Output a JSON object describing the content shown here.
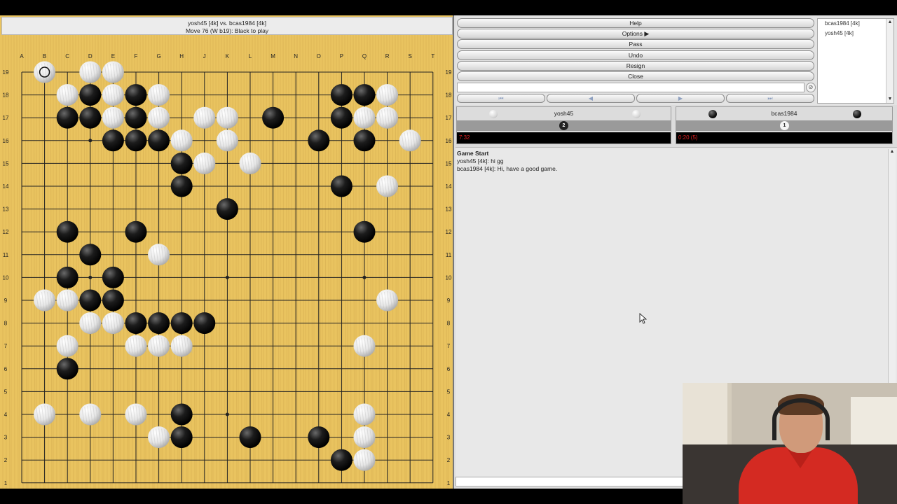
{
  "board": {
    "title": "yosh45 [4k] vs. bcas1984 [4k]",
    "status": "Move 76 (W b19): Black to play",
    "columns": [
      "A",
      "B",
      "C",
      "D",
      "E",
      "F",
      "G",
      "H",
      "J",
      "K",
      "L",
      "M",
      "N",
      "O",
      "P",
      "Q",
      "R",
      "S",
      "T"
    ],
    "rows": [
      "19",
      "18",
      "17",
      "16",
      "15",
      "14",
      "13",
      "12",
      "11",
      "10",
      "9",
      "8",
      "7",
      "6",
      "5",
      "4",
      "3",
      "2",
      "1"
    ],
    "last_move": "B19",
    "black_stones": [
      "D18",
      "F18",
      "P18",
      "Q18",
      "C17",
      "D17",
      "F17",
      "M17",
      "P17",
      "E16",
      "F16",
      "G16",
      "O16",
      "Q16",
      "H15",
      "H14",
      "P14",
      "K13",
      "C12",
      "F12",
      "Q12",
      "D11",
      "C10",
      "E10",
      "D9",
      "E9",
      "F8",
      "G8",
      "H8",
      "J8",
      "C6",
      "H4",
      "H3",
      "L3",
      "O3",
      "P2"
    ],
    "white_stones": [
      "B19",
      "D19",
      "E19",
      "C18",
      "E18",
      "G18",
      "R18",
      "E17",
      "G17",
      "J17",
      "K17",
      "Q17",
      "R17",
      "H16",
      "K16",
      "S16",
      "J15",
      "L15",
      "R14",
      "G11",
      "B9",
      "C9",
      "R9",
      "D8",
      "E8",
      "C7",
      "F7",
      "G7",
      "H7",
      "Q7",
      "B4",
      "D4",
      "F4",
      "Q4",
      "G3",
      "Q3",
      "Q2"
    ]
  },
  "controls": {
    "help_label": "Help",
    "options_label": "Options",
    "pass_label": "Pass",
    "undo_label": "Undo",
    "resign_label": "Resign",
    "close_label": "Close",
    "nav": {
      "first": "⏮",
      "prev": "◀",
      "next": "▶",
      "last": "⏭"
    },
    "clear_icon": "⊘"
  },
  "player_list": [
    "bcas1984 [4k]",
    "yosh45 [4k]"
  ],
  "players": {
    "white": {
      "name": "yosh45",
      "captures": "2",
      "clock": "7:32"
    },
    "black": {
      "name": "bcas1984",
      "captures": "1",
      "clock": "0:20 (5)"
    }
  },
  "chat": {
    "heading": "Game Start",
    "lines": [
      "yosh45 [4k]: hi gg",
      "bcas1984 [4k]: Hi, have a good game."
    ]
  },
  "colors": {
    "board_wood": "#e9c35f",
    "clock_text": "#e02020",
    "window_gray": "#dcdcdc"
  }
}
